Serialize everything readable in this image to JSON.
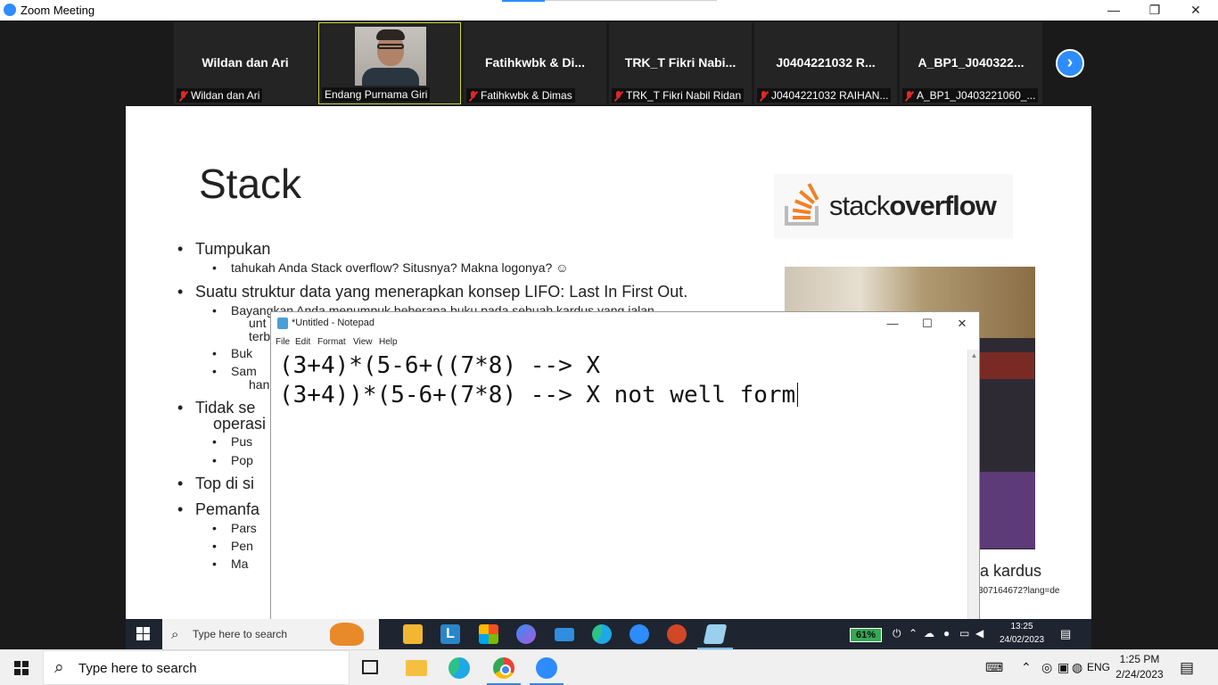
{
  "zoom": {
    "window_title": "Zoom Meeting",
    "controls": {
      "minimize": "—",
      "restore": "❐",
      "close": "✕"
    }
  },
  "participants": [
    {
      "display_name": "Wildan dan Ari",
      "label": "Wildan dan Ari",
      "muted": true
    },
    {
      "display_name": "",
      "label": "Endang Purnama Giri",
      "muted": false,
      "speaking": true
    },
    {
      "display_name": "Fatihkwbk & Di...",
      "label": "Fatihkwbk & Dimas",
      "muted": true
    },
    {
      "display_name": "TRK_T Fikri Nabi...",
      "label": "TRK_T Fikri Nabil Ridan",
      "muted": true
    },
    {
      "display_name": "J0404221032 R...",
      "label": "J0404221032 RAIHAN...",
      "muted": true
    },
    {
      "display_name": "A_BP1_J040322...",
      "label": "A_BP1_J0403221060_...",
      "muted": true
    }
  ],
  "next_page_icon": "›",
  "slide": {
    "title": "Stack",
    "logo_text_light": "stack",
    "logo_text_bold": "overflow",
    "bullets": {
      "b1": "Tumpukan",
      "b1_1": "tahukah Anda Stack overflow? Situsnya? Makna logonya? ☺",
      "b2": "Suatu struktur data yang menerapkan konsep LIFO: Last In First Out.",
      "b2_1": "Bayangkan Anda menumpuk beberapa buku pada sebuah kardus yang jalan",
      "b2_1b": "unt",
      "b2_1c": "terb",
      "b2_2": "Buk",
      "b2_3": "Sam",
      "b2_3b": "han",
      "b3": "Tidak se",
      "b3b": "operasi",
      "b3_1": "Pus",
      "b3_2": "Pop",
      "b4": "Top di si",
      "b5": "Pemanfa",
      "b5_1": "Pars",
      "b5_2": "Pen",
      "b5_3": "Ma"
    },
    "caption": "a kardus",
    "source": "307164672?lang=de"
  },
  "notepad": {
    "title": "*Untitled - Notepad",
    "menu": [
      "File",
      "Edit",
      "Format",
      "View",
      "Help"
    ],
    "lines": [
      "(3+4)*(5-6+((7*8) --> X",
      "(3+4))*(5-6+(7*8) --> X not well form"
    ],
    "controls": {
      "minimize": "—",
      "maximize": "☐",
      "close": "✕"
    }
  },
  "inner_taskbar": {
    "search_placeholder": "Type here to search",
    "battery": "61%",
    "time": "13:25",
    "date": "24/02/2023",
    "pinned": [
      "file-explorer",
      "lync",
      "microsoft-store",
      "copilot",
      "mail",
      "edge",
      "zoom",
      "powerpoint",
      "notepad"
    ]
  },
  "outer_taskbar": {
    "search_placeholder": "Type here to search",
    "language": "ENG",
    "time": "1:25 PM",
    "date": "2/24/2023"
  },
  "colors": {
    "zoom_blue": "#2d8cff",
    "mute_red": "#e02828",
    "speaker_border": "#c8d93a",
    "battery_green": "#34a853"
  }
}
